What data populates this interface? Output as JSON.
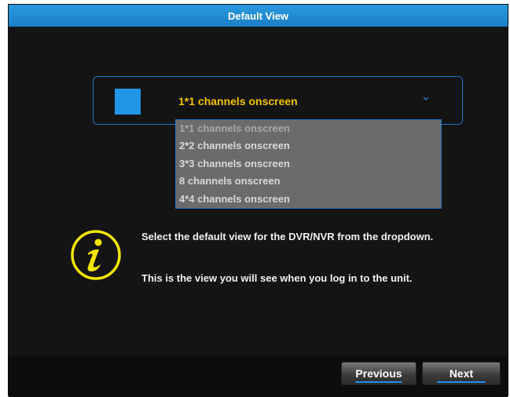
{
  "window": {
    "title": "Default View"
  },
  "dropdown": {
    "selected": "1*1 channels onscreen",
    "options": [
      "1*1 channels onscreen",
      "2*2 channels onscreen",
      "3*3 channels onscreen",
      "8 channels onscreen",
      "4*4 channels onscreen"
    ]
  },
  "info": {
    "line1": "Select the default view for the DVR/NVR from the dropdown.",
    "line2": "This is the view you will see when you log in to the unit."
  },
  "footer": {
    "previous_label": "Previous",
    "next_label": "Next"
  },
  "colors": {
    "accent": "#1e73c8",
    "title_bar": "#2196e6",
    "highlight_text": "#f2c200",
    "info_icon": "#f2e600"
  },
  "icons": {
    "info": "info-icon",
    "chevron": "chevron-down-icon"
  }
}
